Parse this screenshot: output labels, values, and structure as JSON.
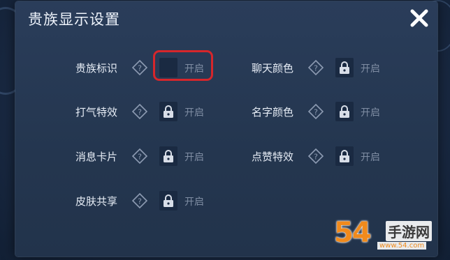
{
  "dialog": {
    "title": "贵族显示设置"
  },
  "settings_left": [
    {
      "label": "贵族标识",
      "state": "开启",
      "locked": false
    },
    {
      "label": "打气特效",
      "state": "开启",
      "locked": true
    },
    {
      "label": "消息卡片",
      "state": "开启",
      "locked": true
    },
    {
      "label": "皮肤共享",
      "state": "开启",
      "locked": true
    }
  ],
  "settings_right": [
    {
      "label": "聊天颜色",
      "state": "开启",
      "locked": true
    },
    {
      "label": "名字颜色",
      "state": "开启",
      "locked": true
    },
    {
      "label": "点赞特效",
      "state": "开启",
      "locked": true
    }
  ],
  "watermark": {
    "number": "54",
    "site": "手游网",
    "url": "www.54.com"
  },
  "colors": {
    "highlight": "#d6262b",
    "watermark_orange": "#f08a1c"
  },
  "icons": {
    "close": "close-icon",
    "help": "help-diamond-icon",
    "lock": "lock-icon"
  }
}
